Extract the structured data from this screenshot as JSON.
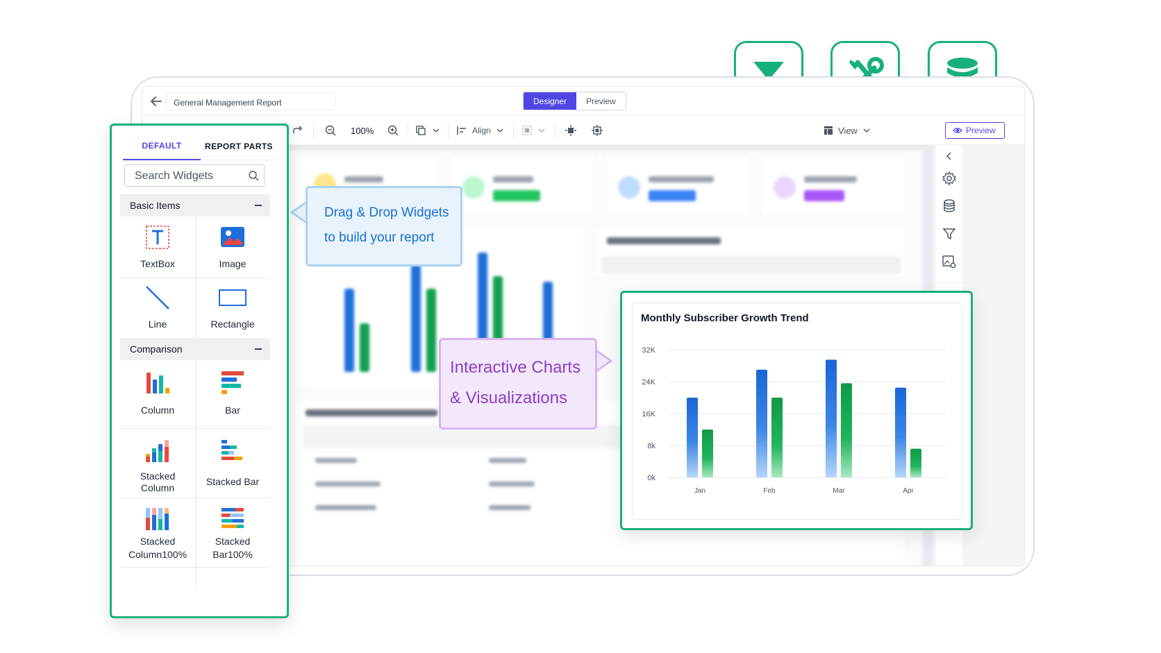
{
  "app": {
    "report_title": "General Management Report",
    "modes": {
      "designer": "Designer",
      "preview": "Preview"
    },
    "toolbar": {
      "zoom": "100%",
      "align": "Align",
      "view": "View",
      "preview": "Preview"
    }
  },
  "panel": {
    "tabs": {
      "default": "DEFAULT",
      "report_parts": "REPORT PARTS"
    },
    "search": {
      "placeholder": "Search Widgets"
    },
    "sections": {
      "basic": {
        "title": "Basic Items",
        "items": {
          "textbox": "TextBox",
          "image": "Image",
          "line": "Line",
          "rectangle": "Rectangle"
        }
      },
      "comparison": {
        "title": "Comparison",
        "items": {
          "column": "Column",
          "bar": "Bar",
          "stacked_column_1": "Stacked",
          "stacked_column_2": "Column",
          "stacked_bar": "Stacked Bar",
          "stacked_column100_1": "Stacked",
          "stacked_column100_2": "Column100%",
          "stacked_bar100_1": "Stacked",
          "stacked_bar100_2": "Bar100%"
        }
      }
    }
  },
  "callouts": {
    "drag_line1": "Drag & Drop Widgets",
    "drag_line2": "to build your report",
    "charts_line1": "Interactive Charts",
    "charts_line2": "& Visualizations"
  },
  "icons": {
    "badges": [
      "filter-icon",
      "tools-icon",
      "database-icon"
    ],
    "rail": [
      "chevron-left-icon",
      "gear-icon",
      "database-icon",
      "filter-icon",
      "image-settings-icon"
    ]
  },
  "colors": {
    "accent": "#17b07d",
    "primary": "#4f46e5",
    "blue_bar": "#1e6fd9",
    "green_bar": "#11a150"
  },
  "chart_data": {
    "type": "bar",
    "title": "Monthly Subscriber Growth Trend",
    "categories": [
      "Jan",
      "Feb",
      "Mar",
      "Apr"
    ],
    "series": [
      {
        "values": [
          20000,
          27000,
          29500,
          22500
        ]
      },
      {
        "values": [
          12000,
          20000,
          23600,
          7200
        ]
      }
    ],
    "ylim": [
      0,
      32000
    ],
    "yticks": [
      "0k",
      "8k",
      "16K",
      "24K",
      "32K"
    ],
    "grid": true
  }
}
